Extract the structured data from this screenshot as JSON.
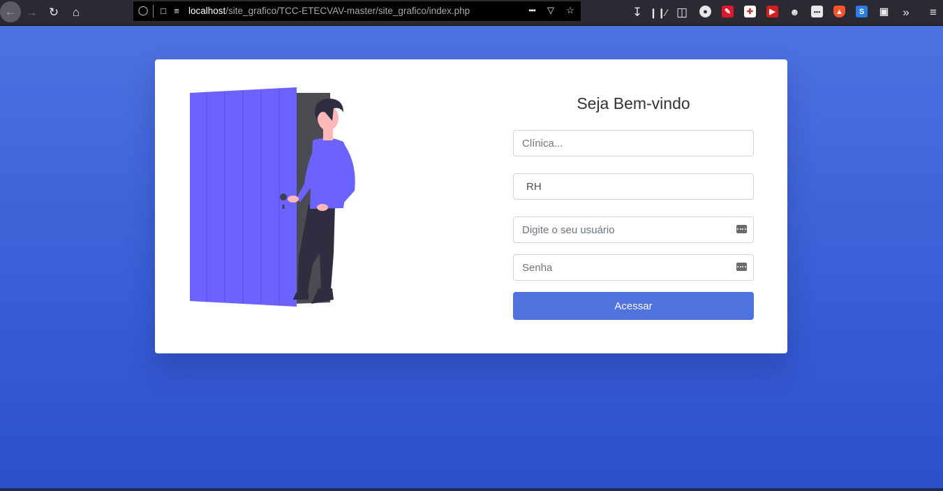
{
  "browser": {
    "url_host": "localhost",
    "url_path": "/site_grafico/TCC-ETECVAV-master/site_grafico/index.php",
    "more_label": "•••"
  },
  "login": {
    "title": "Seja Bem-vindo",
    "clinica_placeholder": "Clínica...",
    "rh_value": "RH",
    "usuario_placeholder": "Digite o seu usuário",
    "senha_placeholder": "Senha",
    "submit_label": "Acessar"
  },
  "colors": {
    "primary": "#4e73df",
    "background_top": "#4f74e1",
    "background_bottom": "#2c4fca",
    "door": "#6c63ff",
    "toolbar": "#2b2a33"
  },
  "icons": {
    "password_manager": "key-icon",
    "illustration": "person-opening-door"
  }
}
